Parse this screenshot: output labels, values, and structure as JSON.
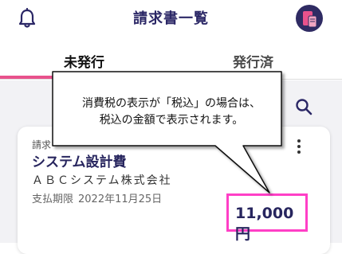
{
  "header": {
    "title": "請求書一覧",
    "left_icon": "bell-icon",
    "right_icon": "avatar-doc-phone-icon"
  },
  "tabs": [
    {
      "label": "未発行",
      "active": true
    },
    {
      "label": "発行済",
      "active": false
    }
  ],
  "search": {
    "icon": "search-icon"
  },
  "invoice_card": {
    "label_partial": "請求",
    "title": "システム設計費",
    "company": "ＡＢＣシステム株式会社",
    "due_label": "支払期限",
    "due_date": "2022年11月25日",
    "amount": "11,000円",
    "menu_icon": "kebab-menu-icon"
  },
  "callout": {
    "line1": "消費税の表示が「税込」の場合は、",
    "line2": "税込の金額で表示されます。"
  },
  "colors": {
    "primary": "#2b2766",
    "tab_indicator": "#e8528c",
    "highlight_box": "#ff3fc6",
    "content_bg": "#f2f2f5"
  }
}
